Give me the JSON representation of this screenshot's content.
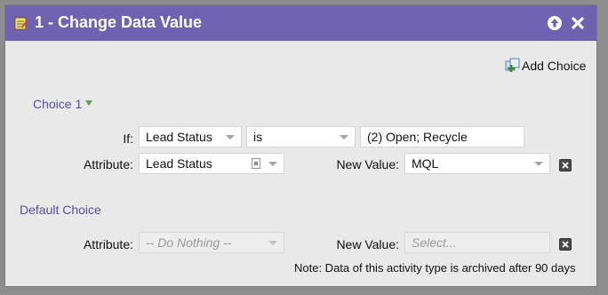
{
  "title": "1 - Change Data Value",
  "header": {
    "add_choice_label": "Add Choice",
    "title_icon": "notepad-icon",
    "collapse_icon": "arrow-up-circle-icon",
    "close_icon": "close-x-icon"
  },
  "choice1": {
    "heading": "Choice 1",
    "if_label": "If:",
    "if_field": "Lead Status",
    "operator": "is",
    "if_value": "(2) Open; Recycle",
    "attribute_label": "Attribute:",
    "attribute_value": "Lead Status",
    "new_value_label": "New Value:",
    "new_value": "MQL"
  },
  "default_choice": {
    "heading": "Default Choice",
    "attribute_label": "Attribute:",
    "attribute_placeholder": "-- Do Nothing --",
    "new_value_label": "New Value:",
    "new_value_placeholder": "Select..."
  },
  "note": "Note: Data of this activity type is archived after 90 days",
  "colors": {
    "titlebar": "#6f63b1",
    "section_label": "#574fa0",
    "panel_bg": "#e9e9e9"
  }
}
